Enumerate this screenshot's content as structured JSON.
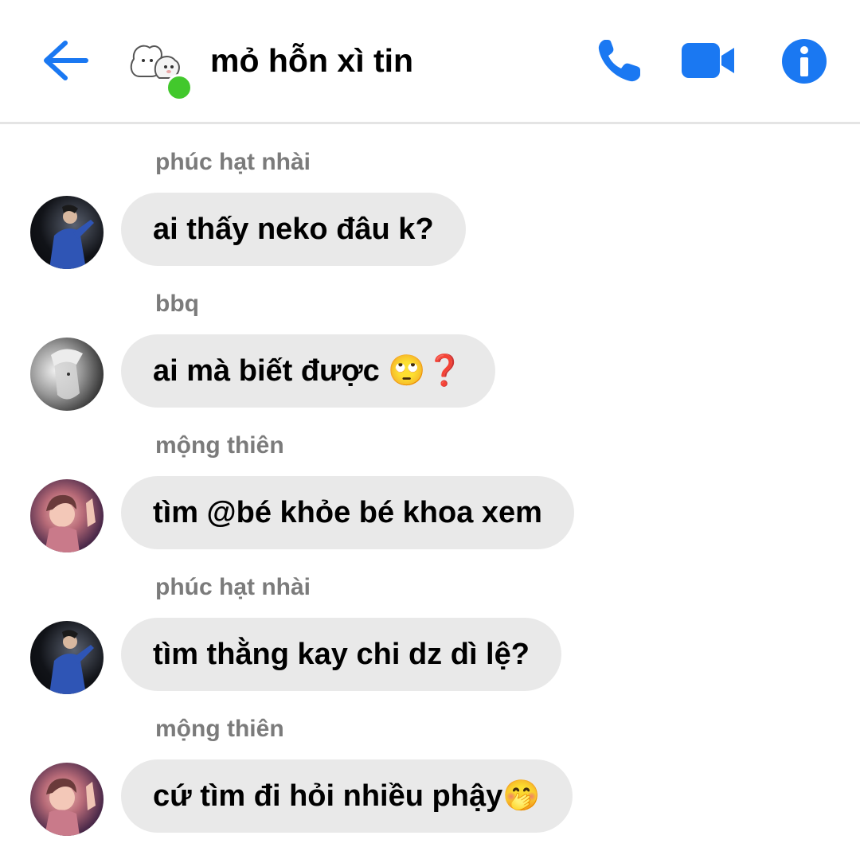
{
  "header": {
    "title": "mỏ hỗn xì tin",
    "online_color": "#42c82c",
    "accent": "#1a78f2",
    "icons": [
      "back-arrow-icon",
      "phone-icon",
      "video-camera-icon",
      "info-icon"
    ]
  },
  "messages": [
    {
      "sender": "phúc hạt nhài",
      "text": "ai thấy neko đâu k?",
      "avatar": "avatar-phuc-hat-nhai"
    },
    {
      "sender": "bbq",
      "text": "ai mà biết được 🙄❓",
      "avatar": "avatar-bbq"
    },
    {
      "sender": "mộng thiên",
      "text": "tìm @bé khỏe bé khoa xem",
      "avatar": "avatar-mong-thien"
    },
    {
      "sender": "phúc hạt nhài",
      "text": "tìm thằng kay chi dz dì lệ?",
      "avatar": "avatar-phuc-hat-nhai"
    },
    {
      "sender": "mộng thiên",
      "text": "cứ tìm đi hỏi nhiều phậy🤭",
      "avatar": "avatar-mong-thien"
    }
  ]
}
